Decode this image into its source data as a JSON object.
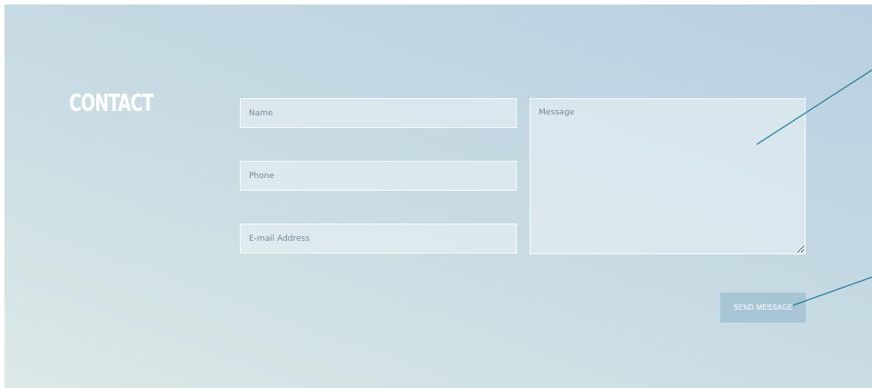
{
  "contact": {
    "heading": "CONTACT",
    "fields": {
      "name_placeholder": "Name",
      "phone_placeholder": "Phone",
      "email_placeholder": "E-mail Address",
      "message_placeholder": "Message"
    },
    "send_label": "SEND MESSAGE"
  },
  "colors": {
    "annotation_line": "#1f7f97",
    "button_bg": "#a7c5d4",
    "heading_text": "#ffffff"
  }
}
